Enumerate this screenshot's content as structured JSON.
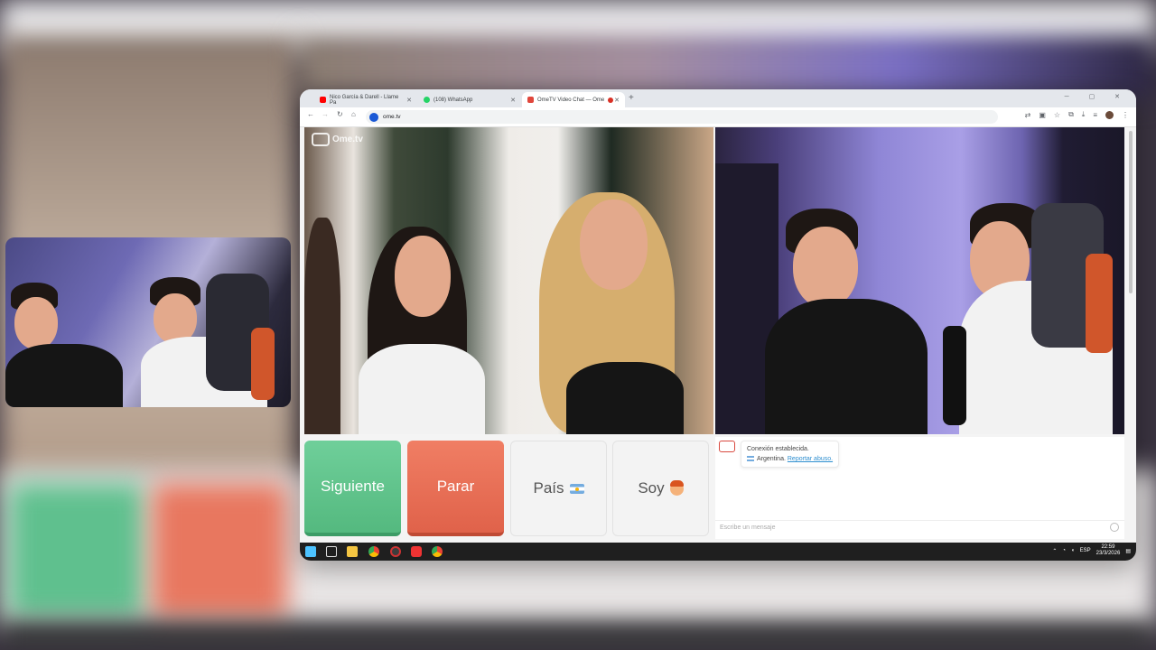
{
  "browser": {
    "tabs": [
      {
        "label": "Nico García & Darell - Llame Pa",
        "icon_color": "#ff0000",
        "active": false
      },
      {
        "label": "(108) WhatsApp",
        "icon_color": "#25d366",
        "active": false
      },
      {
        "label": "OmeTV Video Chat — Ome",
        "icon_color": "#e0463b",
        "active": true
      }
    ],
    "url": "ome.tv"
  },
  "app": {
    "logo_text": "Ome.tv",
    "buttons": {
      "next": "Siguiente",
      "stop": "Parar",
      "country": "País",
      "gender": "Soy"
    },
    "chat": {
      "status": "Conexión establecida.",
      "country": "Argentina.",
      "report": "Reportar abuso.",
      "input_placeholder": "Escribe un mensaje"
    }
  },
  "taskbar": {
    "language": "ESP",
    "time": "22:59",
    "date": "23/3/2026"
  },
  "colors": {
    "next": "#54b97f",
    "stop": "#e0624a",
    "accent": "#e0463b"
  }
}
